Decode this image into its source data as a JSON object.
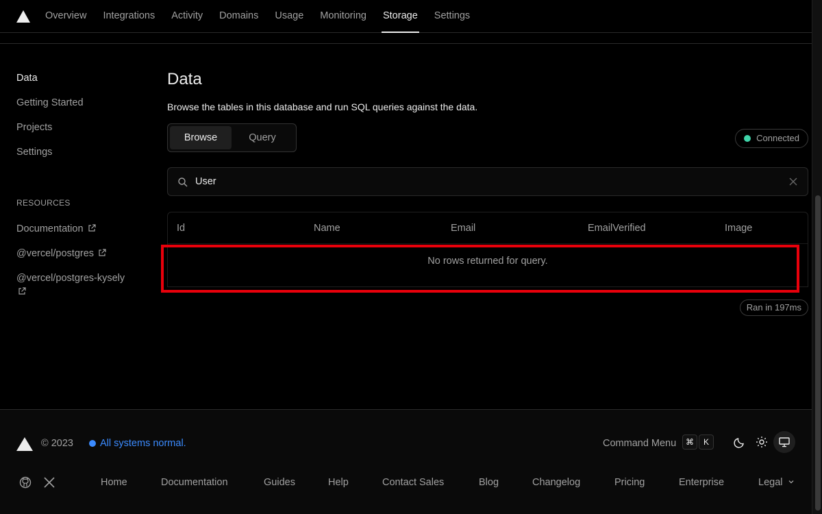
{
  "nav": {
    "items": [
      "Overview",
      "Integrations",
      "Activity",
      "Domains",
      "Usage",
      "Monitoring",
      "Storage",
      "Settings"
    ],
    "active": "Storage"
  },
  "sidebar": {
    "items": [
      "Data",
      "Getting Started",
      "Projects",
      "Settings"
    ],
    "resources_heading": "RESOURCES",
    "resources": [
      "Documentation",
      "@vercel/postgres",
      "@vercel/postgres-kysely"
    ]
  },
  "main": {
    "title": "Data",
    "description": "Browse the tables in this database and run SQL queries against the data.",
    "tabs": [
      "Browse",
      "Query"
    ],
    "status": "Connected",
    "search_value": "User",
    "columns": [
      "Id",
      "Name",
      "Email",
      "EmailVerified",
      "Image"
    ],
    "empty_message": "No rows returned for query.",
    "ran": "Ran in 197ms"
  },
  "footer": {
    "copyright": "© 2023",
    "system_status": "All systems normal.",
    "command_menu": "Command Menu",
    "kbd1": "⌘",
    "kbd2": "K",
    "links": [
      "Home",
      "Documentation",
      "Guides",
      "Help",
      "Contact Sales",
      "Blog",
      "Changelog",
      "Pricing",
      "Enterprise"
    ],
    "legal": "Legal"
  },
  "colors": {
    "accent": "#e8000b",
    "status_green": "#3fd4a9",
    "link_blue": "#3b8bff"
  }
}
